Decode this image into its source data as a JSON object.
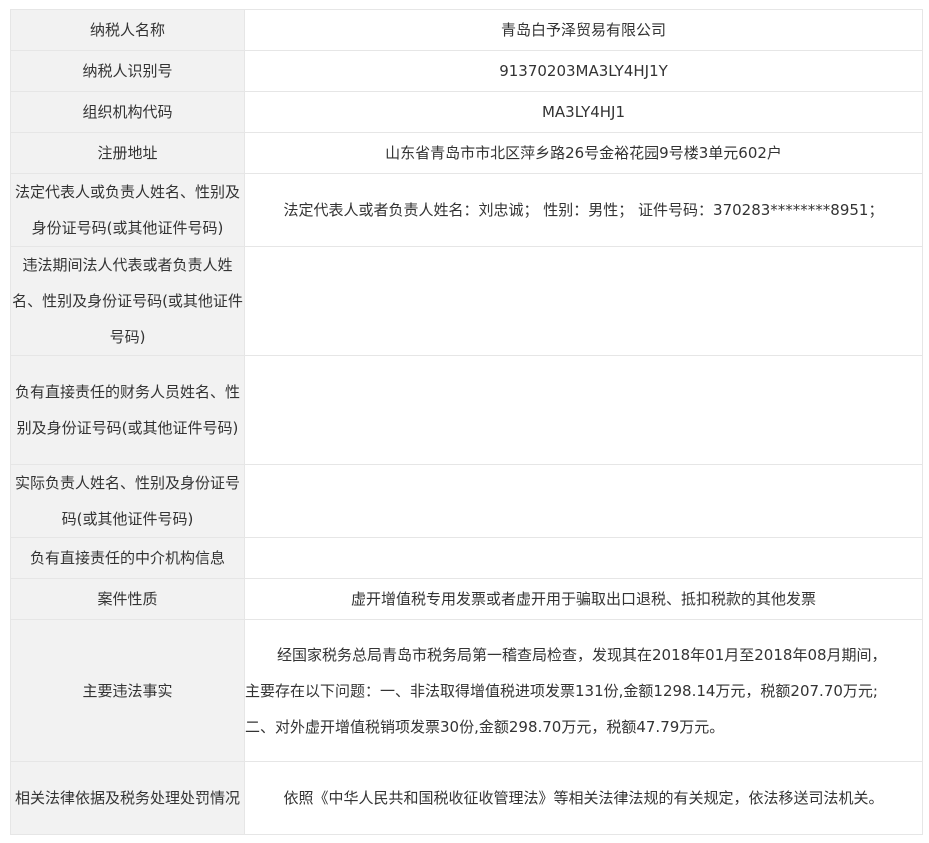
{
  "rows": [
    {
      "label": "纳税人名称",
      "value": "青岛白予泽贸易有限公司"
    },
    {
      "label": "纳税人识别号",
      "value": "91370203MA3LY4HJ1Y"
    },
    {
      "label": "组织机构代码",
      "value": "MA3LY4HJ1"
    },
    {
      "label": "注册地址",
      "value": "山东省青岛市市北区萍乡路26号金裕花园9号楼3单元602户"
    },
    {
      "label": "法定代表人或负责人姓名、性别及身份证号码(或其他证件号码)",
      "value": "法定代表人或者负责人姓名：刘忠诚； 性别：男性； 证件号码：370283********8951；"
    },
    {
      "label": "违法期间法人代表或者负责人姓名、性别及身份证号码(或其他证件号码)",
      "value": ""
    },
    {
      "label": "负有直接责任的财务人员姓名、性别及身份证号码(或其他证件号码)",
      "value": ""
    },
    {
      "label": "实际负责人姓名、性别及身份证号码(或其他证件号码)",
      "value": ""
    },
    {
      "label": "负有直接责任的中介机构信息",
      "value": ""
    },
    {
      "label": "案件性质",
      "value": "虚开增值税专用发票或者虚开用于骗取出口退税、抵扣税款的其他发票"
    },
    {
      "label": "主要违法事实",
      "lines": [
        "经国家税务总局青岛市税务局第一稽查局检查，发现其在2018年01月至2018年08月期间，",
        "主要存在以下问题：一、非法取得增值税进项发票131份,金额1298.14万元，税额207.70万元;",
        "二、对外虚开增值税销项发票30份,金额298.70万元，税额47.79万元。"
      ]
    },
    {
      "label": "相关法律依据及税务处理处罚情况",
      "value": "依照《中华人民共和国税收征收管理法》等相关法律法规的有关规定，依法移送司法机关。"
    }
  ]
}
